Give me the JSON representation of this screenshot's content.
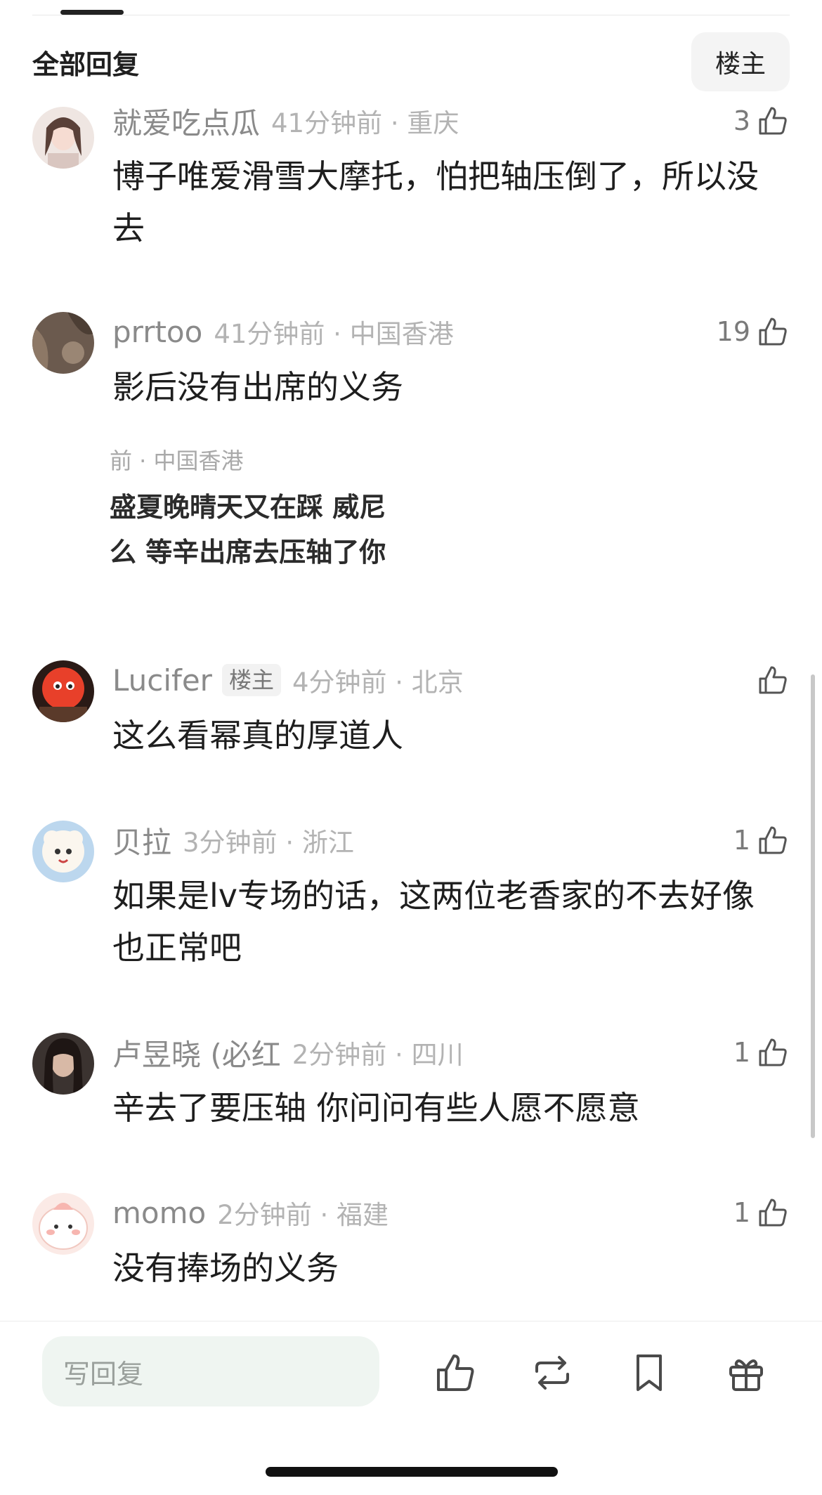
{
  "header": {
    "section_title": "全部回复",
    "op_filter_label": "楼主"
  },
  "comments": [
    {
      "username": "就爱吃点瓜",
      "time_location": "41分钟前 · 重庆",
      "likes": "3",
      "text": "博子唯爱滑雪大摩托，怕把轴压倒了，所以没去"
    },
    {
      "username": "prrtoo",
      "time_location": "41分钟前 · 中国香港",
      "likes": "19",
      "text": "影后没有出席的义务"
    },
    {
      "username": "Lucifer",
      "badge": "楼主",
      "time_location": "4分钟前 · 北京",
      "likes": "",
      "text": "这么看幂真的厚道人"
    },
    {
      "username": "贝拉",
      "time_location": "3分钟前 · 浙江",
      "likes": "1",
      "text": "如果是lv专场的话，这两位老香家的不去好像也正常吧"
    },
    {
      "username": "卢昱晓 (必红",
      "time_location": "2分钟前 · 四川",
      "likes": "1",
      "text": "辛去了要压轴 你问问有些人愿不愿意"
    },
    {
      "username": "momo",
      "time_location": "2分钟前 · 福建",
      "likes": "1",
      "text": "没有捧场的义务"
    }
  ],
  "quoted_image": {
    "meta": "前 · 中国香港",
    "line1": "盛夏晚晴天又在踩 威尼",
    "line2": "么 等辛出席去压轴了你"
  },
  "bottom_bar": {
    "reply_placeholder": "写回复"
  },
  "icons": {
    "like": "thumbs-up-icon",
    "repost": "repost-icon",
    "bookmark": "bookmark-icon",
    "gift": "gift-icon"
  }
}
